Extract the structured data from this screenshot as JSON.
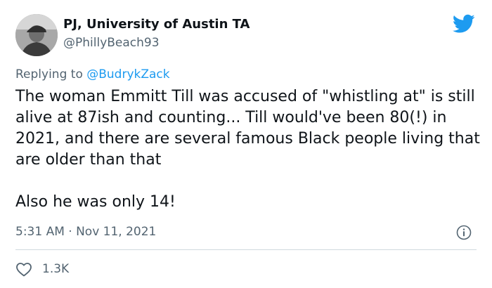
{
  "author": {
    "display_name": "PJ, University of Austin TA",
    "handle": "@PhillyBeach93",
    "avatar_icon": "profile-photo-avatar"
  },
  "reply": {
    "prefix": "Replying to ",
    "mention": "@BudrykZack"
  },
  "tweet": {
    "paragraphs": [
      "The woman Emmitt Till was accused of \"whistling at\" is still alive at 87ish and counting... Till would've been 80(!) in 2021, and there are several famous Black people living that are older than that",
      "Also he was only 14!"
    ]
  },
  "meta": {
    "timestamp": "5:31 AM · Nov 11, 2021"
  },
  "actions": {
    "like_count": "1.3K"
  },
  "colors": {
    "twitter_blue": "#1d9bf0",
    "text_primary": "#0f1419",
    "text_secondary": "#536471",
    "divider": "#cfd9de"
  },
  "icons": {
    "brand": "twitter-bird-icon",
    "info": "info-icon",
    "like": "heart-icon"
  }
}
